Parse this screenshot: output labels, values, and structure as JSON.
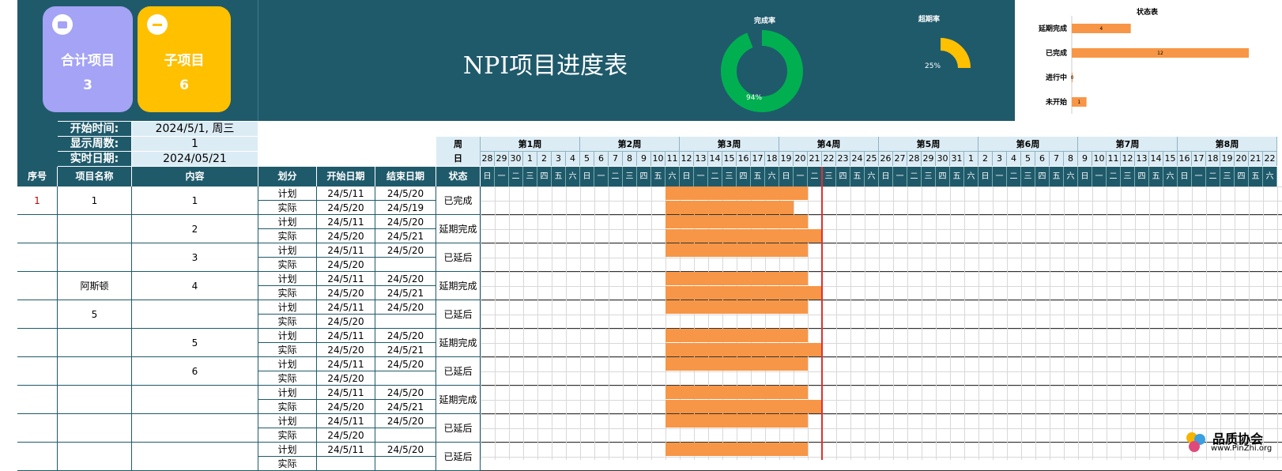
{
  "dashboard": {
    "total_label": "合计项目",
    "total_value": "3",
    "sub_label": "子项目",
    "sub_value": "6",
    "title": "NPI项目进度表",
    "completion_label": "完成率",
    "completion_pct": "94%",
    "completion_value": 0.94,
    "overdue_label": "超期率",
    "overdue_pct": "25%",
    "overdue_value": 0.25,
    "status_chart_title": "状态表"
  },
  "chart_data": {
    "type": "bar",
    "title": "状态表",
    "categories": [
      "延期完成",
      "已完成",
      "进行中",
      "未开始"
    ],
    "values": [
      4,
      12,
      0,
      1
    ],
    "color": "#f79646"
  },
  "info": {
    "start_label": "开始时间:",
    "start_value": "2024/5/1, 周三",
    "weeks_label": "显示周数:",
    "weeks_value": "1",
    "now_label": "实时日期:",
    "now_value": "2024/05/21"
  },
  "calendar": {
    "week_row_label": "周",
    "day_row_label": "日",
    "weeks": [
      "第1周",
      "第2周",
      "第3周",
      "第4周",
      "第5周",
      "第6周",
      "第7周",
      "第8周"
    ],
    "days": [
      "28",
      "29",
      "30",
      "1",
      "2",
      "3",
      "4",
      "5",
      "6",
      "7",
      "8",
      "9",
      "10",
      "11",
      "12",
      "13",
      "14",
      "15",
      "16",
      "17",
      "18",
      "19",
      "20",
      "21",
      "22",
      "23",
      "24",
      "25",
      "26",
      "27",
      "28",
      "29",
      "30",
      "31",
      "1",
      "2",
      "3",
      "4",
      "5",
      "6",
      "7",
      "8",
      "9",
      "10",
      "11",
      "12",
      "13",
      "14",
      "15",
      "16",
      "17",
      "18",
      "19",
      "20",
      "21",
      "22"
    ],
    "weekdays": [
      "日",
      "一",
      "二",
      "三",
      "四",
      "五",
      "六",
      "日",
      "一",
      "二",
      "三",
      "四",
      "五",
      "六",
      "日",
      "一",
      "二",
      "三",
      "四",
      "五",
      "六",
      "日",
      "一",
      "二",
      "三",
      "四",
      "五",
      "六",
      "日",
      "一",
      "二",
      "三",
      "四",
      "五",
      "六",
      "日",
      "一",
      "二",
      "三",
      "四",
      "五",
      "六",
      "日",
      "一",
      "二",
      "三",
      "四",
      "五",
      "六",
      "日",
      "一",
      "二",
      "三",
      "四",
      "五",
      "六"
    ]
  },
  "table": {
    "headers": [
      "序号",
      "项目名称",
      "内容",
      "划分",
      "开始日期",
      "结束日期",
      "状态"
    ],
    "rows": [
      {
        "no": "1",
        "project": "1",
        "content": "1",
        "plan_start": "24/5/11",
        "plan_end": "24/5/20",
        "act_start": "24/5/20",
        "act_end": "24/5/19",
        "status": "已完成"
      },
      {
        "no": "",
        "project": "",
        "content": "2",
        "plan_start": "24/5/11",
        "plan_end": "24/5/20",
        "act_start": "24/5/20",
        "act_end": "24/5/21",
        "status": "延期完成"
      },
      {
        "no": "",
        "project": "",
        "content": "3",
        "plan_start": "24/5/11",
        "plan_end": "24/5/20",
        "act_start": "24/5/20",
        "act_end": "",
        "status": "已延后"
      },
      {
        "no": "",
        "project": "阿斯顿",
        "content": "4",
        "plan_start": "24/5/11",
        "plan_end": "24/5/20",
        "act_start": "24/5/20",
        "act_end": "24/5/21",
        "status": "延期完成"
      },
      {
        "no": "",
        "project": "5",
        "content": "",
        "plan_start": "24/5/11",
        "plan_end": "24/5/20",
        "act_start": "24/5/20",
        "act_end": "",
        "status": "已延后"
      },
      {
        "no": "",
        "project": "",
        "content": "5",
        "plan_start": "24/5/11",
        "plan_end": "24/5/20",
        "act_start": "24/5/20",
        "act_end": "24/5/21",
        "status": "延期完成"
      },
      {
        "no": "",
        "project": "",
        "content": "6",
        "plan_start": "24/5/11",
        "plan_end": "24/5/20",
        "act_start": "24/5/20",
        "act_end": "",
        "status": "已延后"
      },
      {
        "no": "",
        "project": "",
        "content": "",
        "plan_start": "24/5/11",
        "plan_end": "24/5/20",
        "act_start": "24/5/20",
        "act_end": "24/5/21",
        "status": "延期完成"
      },
      {
        "no": "",
        "project": "",
        "content": "",
        "plan_start": "24/5/11",
        "plan_end": "24/5/20",
        "act_start": "24/5/20",
        "act_end": "",
        "status": "已延后"
      },
      {
        "no": "",
        "project": "",
        "content": "",
        "plan_start": "24/5/11",
        "plan_end": "24/5/20",
        "act_start": "",
        "act_end": "",
        "status": "已延后"
      }
    ],
    "plan_label": "计划",
    "act_label": "实际"
  },
  "watermark": {
    "name": "品质协会",
    "url": "www.PinZhi.org"
  }
}
